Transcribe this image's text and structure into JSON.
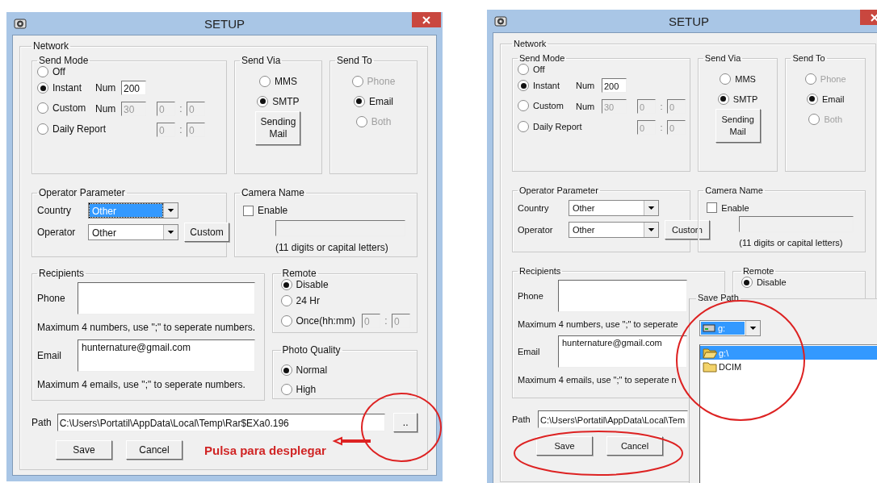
{
  "windows": [
    {
      "title": "SETUP",
      "network_label": "Network",
      "send_mode": {
        "label": "Send Mode",
        "options": [
          {
            "label": "Off",
            "selected": false
          },
          {
            "label": "Instant",
            "selected": true,
            "num": {
              "label": "Num",
              "value": "200",
              "disabled": false
            }
          },
          {
            "label": "Custom",
            "selected": false,
            "num": {
              "label": "Num",
              "value": "30",
              "disabled": true
            },
            "time": {
              "hour": "0",
              "separator": ":",
              "minute": "0",
              "disabled": true
            }
          },
          {
            "label": "Daily Report",
            "selected": false,
            "time": {
              "hour": "0",
              "separator": ":",
              "minute": "0",
              "disabled": true
            }
          }
        ]
      },
      "send_via": {
        "label": "Send Via",
        "options": [
          {
            "label": "MMS",
            "selected": false
          },
          {
            "label": "SMTP",
            "selected": true
          }
        ],
        "button": "Sending Mail"
      },
      "send_to": {
        "label": "Send To",
        "options": [
          {
            "label": "Phone",
            "selected": false,
            "disabled": true
          },
          {
            "label": "Email",
            "selected": true,
            "disabled": false
          },
          {
            "label": "Both",
            "selected": false,
            "disabled": true
          }
        ]
      },
      "operator_parameter": {
        "label": "Operator Parameter",
        "fields": [
          {
            "label": "Country",
            "value": "Other",
            "highlighted": true
          },
          {
            "label": "Operator",
            "value": "Other",
            "highlighted": false
          }
        ],
        "button": "Custom"
      },
      "camera_name": {
        "label": "Camera Name",
        "enable": {
          "label": "Enable",
          "checked": false
        },
        "hint": "(11 digits or capital letters)"
      },
      "recipients": {
        "label": "Recipients",
        "phone": {
          "label": "Phone"
        },
        "phone_hint": "Maximum 4 numbers, use \";\" to seperate numbers.",
        "email": {
          "label": "Email",
          "value": "hunternature@gmail.com"
        },
        "email_hint": "Maximum 4 emails, use \";\" to seperate numbers."
      },
      "remote": {
        "label": "Remote",
        "options": [
          {
            "label": "Disable",
            "selected": true
          },
          {
            "label": "24 Hr",
            "selected": false
          },
          {
            "label": "Once(hh:mm)",
            "selected": false,
            "time": {
              "hour": "0",
              "separator": ":",
              "minute": "0",
              "disabled": true
            }
          }
        ]
      },
      "photo_quality": {
        "label": "Photo Quality",
        "options": [
          {
            "label": "Normal",
            "selected": true
          },
          {
            "label": "High",
            "selected": false
          }
        ]
      },
      "path": {
        "label": "Path",
        "value": "C:\\Users\\Portatil\\AppData\\Local\\Temp\\Rar$EXa0.196",
        "browse": ".."
      },
      "buttons": [
        "Save",
        "Cancel"
      ],
      "note": "Pulsa para desplegar"
    },
    {
      "title": "SETUP",
      "network_label": "Network",
      "send_mode": {
        "label": "Send Mode",
        "options": [
          {
            "label": "Off",
            "selected": false
          },
          {
            "label": "Instant",
            "selected": true,
            "num": {
              "label": "Num",
              "value": "200",
              "disabled": false
            }
          },
          {
            "label": "Custom",
            "selected": false,
            "num": {
              "label": "Num",
              "value": "30",
              "disabled": true
            },
            "time": {
              "hour": "0",
              "separator": ":",
              "minute": "0",
              "disabled": true
            }
          },
          {
            "label": "Daily Report",
            "selected": false,
            "time": {
              "hour": "0",
              "separator": ":",
              "minute": "0",
              "disabled": true
            }
          }
        ]
      },
      "send_via": {
        "label": "Send Via",
        "options": [
          {
            "label": "MMS",
            "selected": false
          },
          {
            "label": "SMTP",
            "selected": true
          }
        ],
        "button": "Sending Mail"
      },
      "send_to": {
        "label": "Send To",
        "options": [
          {
            "label": "Phone",
            "selected": false,
            "disabled": true
          },
          {
            "label": "Email",
            "selected": true,
            "disabled": false
          },
          {
            "label": "Both",
            "selected": false,
            "disabled": true
          }
        ]
      },
      "operator_parameter": {
        "label": "Operator Parameter",
        "fields": [
          {
            "label": "Country",
            "value": "Other",
            "highlighted": false
          },
          {
            "label": "Operator",
            "value": "Other",
            "highlighted": false
          }
        ],
        "button": "Custom"
      },
      "camera_name": {
        "label": "Camera Name",
        "enable": {
          "label": "Enable",
          "checked": false
        },
        "hint": "(11 digits or capital letters)"
      },
      "recipients": {
        "label": "Recipients",
        "phone": {
          "label": "Phone"
        },
        "phone_hint": "Maximum 4 numbers, use \";\" to seperate",
        "email": {
          "label": "Email",
          "value": "hunternature@gmail.com"
        },
        "email_hint": "Maximum 4 emails, use \";\" to seperate n"
      },
      "remote": {
        "label": "Remote",
        "options": [
          {
            "label": "Disable",
            "selected": true
          }
        ]
      },
      "path": {
        "label": "Path",
        "value": "C:\\Users\\Portatil\\AppData\\Local\\Tem"
      },
      "buttons": [
        "Save",
        "Cancel"
      ],
      "save_path": {
        "title": "Save Path",
        "drive": "g:",
        "folders": [
          {
            "label": "g:\\",
            "selected": true,
            "open": true
          },
          {
            "label": "DCIM",
            "selected": false,
            "open": false
          }
        ]
      }
    }
  ]
}
